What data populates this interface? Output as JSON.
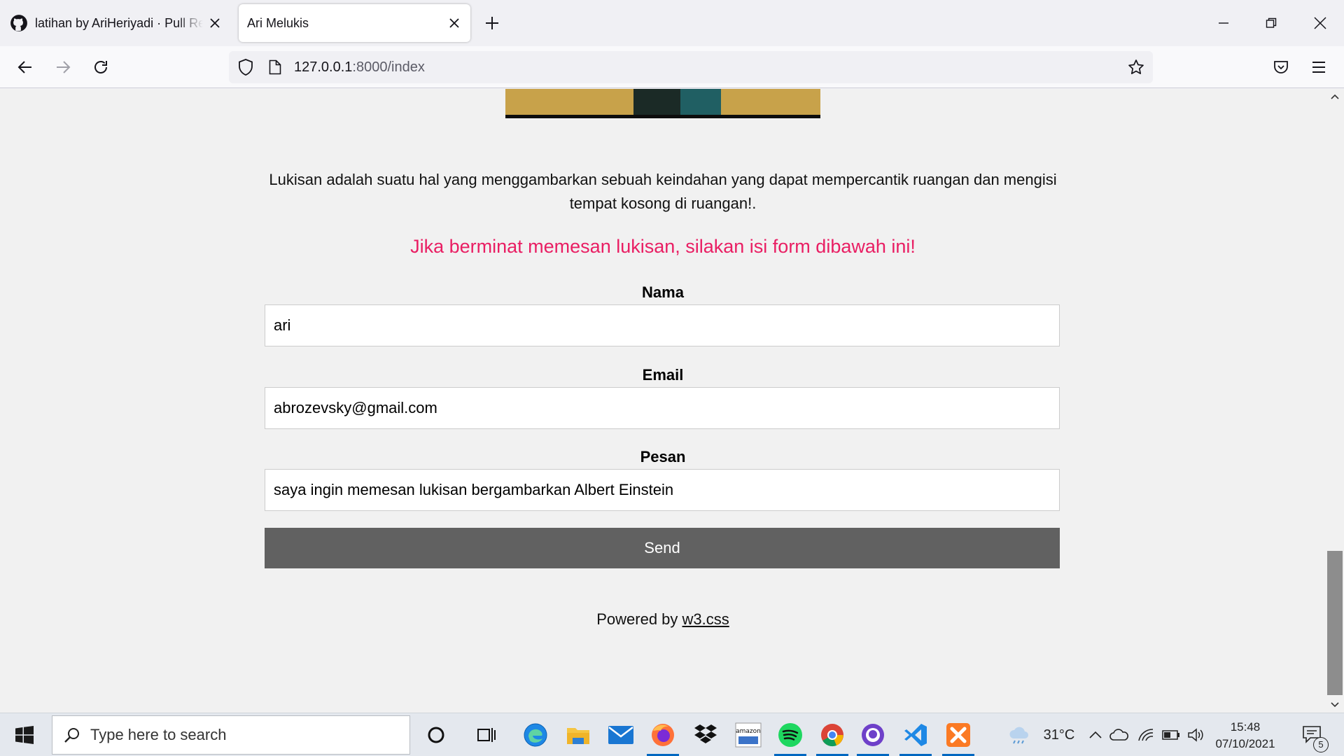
{
  "browser": {
    "tabs": [
      {
        "title": "latihan by AriHeriyadi · Pull Requests",
        "favicon": "github-icon",
        "active": false
      },
      {
        "title": "Ari Melukis",
        "favicon": "",
        "active": true
      }
    ],
    "url": {
      "host": "127.0.0.1",
      "path": ":8000/index"
    }
  },
  "page": {
    "description": "Lukisan adalah suatu hal yang menggambarkan sebuah keindahan yang dapat mempercantik ruangan dan mengisi tempat kosong di ruangan!.",
    "cta": "Jika berminat memesan lukisan, silakan isi form dibawah ini!",
    "form": {
      "nama_label": "Nama",
      "nama_value": "ari",
      "email_label": "Email",
      "email_value": "abrozevsky@gmail.com",
      "pesan_label": "Pesan",
      "pesan_value": "saya ingin memesan lukisan bergambarkan Albert Einstein",
      "send_label": "Send"
    },
    "footer": {
      "powered_prefix": "Powered by ",
      "powered_link": "w3.css"
    }
  },
  "colors": {
    "accent_pink": "#e91e63",
    "button_grey": "#616161",
    "page_bg": "#f1f1f1"
  },
  "taskbar": {
    "search_placeholder": "Type here to search",
    "apps": [
      "cortana-icon",
      "task-view-icon",
      "edge-icon",
      "file-explorer-icon",
      "mail-icon",
      "firefox-icon",
      "dropbox-icon",
      "amazon-icon",
      "spotify-icon",
      "chrome-icon",
      "github-desktop-icon",
      "vscode-icon",
      "xampp-icon"
    ],
    "weather": "31°C",
    "time": "15:48",
    "date": "07/10/2021",
    "notification_count": "5"
  }
}
